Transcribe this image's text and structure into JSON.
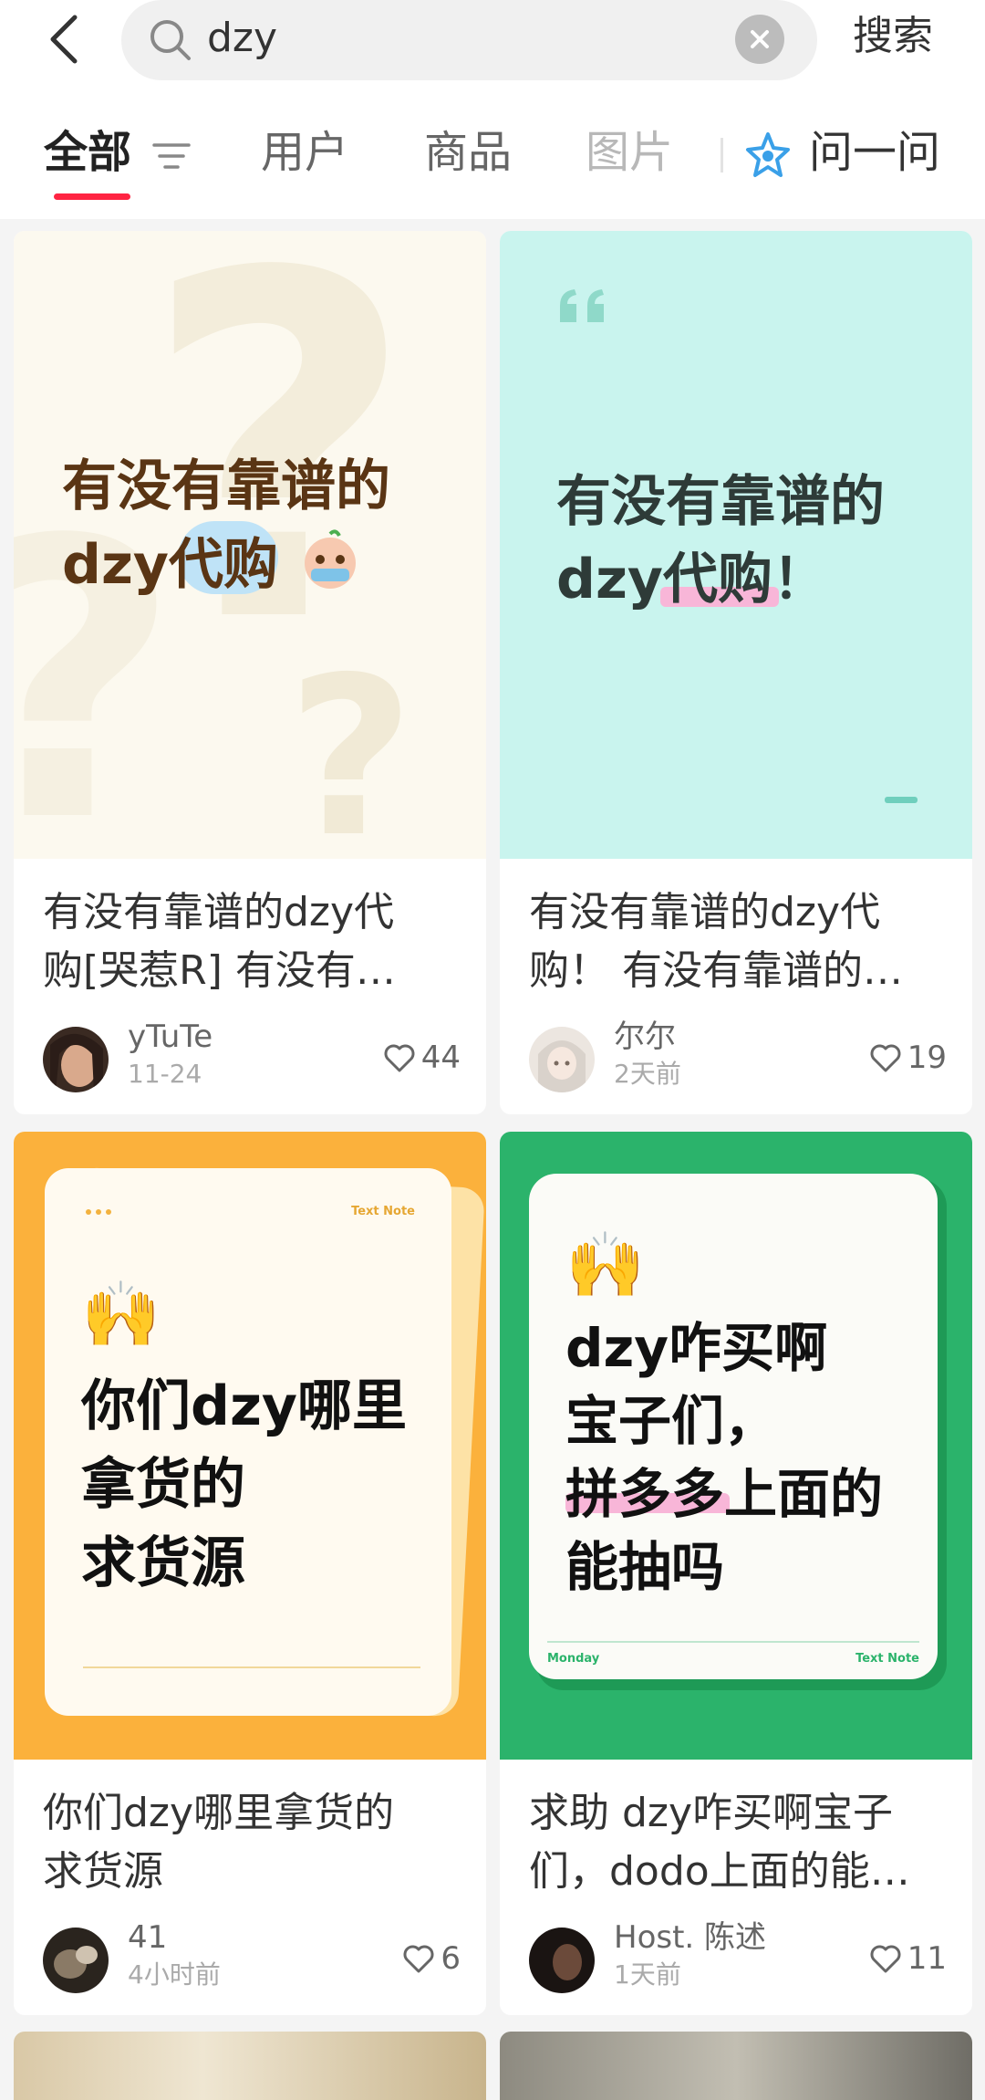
{
  "header": {
    "search_query": "dzy",
    "search_button": "搜索"
  },
  "tabs": [
    {
      "label": "全部"
    },
    {
      "label": "用户"
    },
    {
      "label": "商品"
    },
    {
      "label": "图片"
    },
    {
      "label": "问一问"
    }
  ],
  "colors": {
    "accent": "#ff2442",
    "card1_bg": "#fcf9ef",
    "card2_bg": "#c9f4ee",
    "card3_bg": "#fbb13c",
    "card4_bg": "#2bb36b"
  },
  "cards": [
    {
      "cover_line1": "有没有靠谱的",
      "cover_line2": "dzy代购",
      "title_line1": "有没有靠谱的dzy代",
      "title_line2": "购[哭惹R] 有没有…",
      "author": "yTuTe",
      "date": "11-24",
      "likes": "44"
    },
    {
      "cover_line1": "有没有靠谱的",
      "cover_line2": "dzy代购！",
      "title_line1": "有没有靠谱的dzy代",
      "title_line2": "购！ 有没有靠谱的…",
      "author": "尔尔",
      "date": "2天前",
      "likes": "19"
    },
    {
      "cover_tag": "Text Note",
      "cover_line1": "你们dzy哪里",
      "cover_line2": "拿货的",
      "cover_line3": "求货源",
      "title_line1": "你们dzy哪里拿货的",
      "title_line2": "求货源",
      "author": "41",
      "date": "4小时前",
      "likes": "6"
    },
    {
      "cover_tag_left": "Monday",
      "cover_tag_right": "Text Note",
      "cover_line1": "dzy咋买啊",
      "cover_line2": "宝子们，",
      "cover_line3": "拼多多上面的",
      "cover_line4": "能抽吗",
      "title_line1": "求助 dzy咋买啊宝子",
      "title_line2": "们，dodo上面的能…",
      "author": "Host. 陈述",
      "date": "1天前",
      "likes": "11"
    }
  ]
}
